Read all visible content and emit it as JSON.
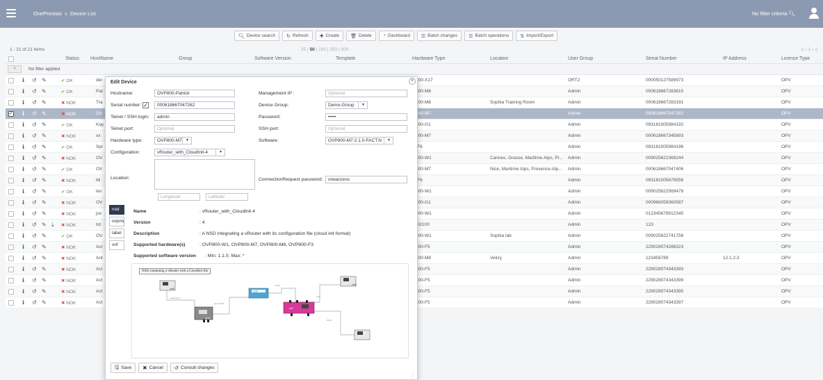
{
  "topbar": {
    "app": "OneProvisio",
    "separator": "»",
    "page": "Device List",
    "filter_criteria": "No filter criteria"
  },
  "toolbar": [
    {
      "label": "Device search",
      "icon": "search-icon"
    },
    {
      "label": "Refresh",
      "icon": "refresh-icon"
    },
    {
      "label": "Create",
      "icon": "plus-icon"
    },
    {
      "label": "Delete",
      "icon": "trash-icon"
    },
    {
      "label": "Dashboard",
      "icon": "dashboard-icon"
    },
    {
      "label": "Batch changes",
      "icon": "list-icon"
    },
    {
      "label": "Batch operations",
      "icon": "list-icon"
    },
    {
      "label": "Import/Export",
      "icon": "import-icon"
    }
  ],
  "list": {
    "count_text": "1 - 21 of 21 items",
    "pager": {
      "p25": "25",
      "p50": "50",
      "p100": "100",
      "p250": "250",
      "p500": "500",
      "sep": "|"
    },
    "pager_right": "|‹  ‹  1  ›  ›|",
    "filter_text": "No filter applied",
    "columns": {
      "status": "Status",
      "hostname": "HostName",
      "group": "Group",
      "software": "Software Version",
      "template": "Template",
      "hardware": "Hardware Type",
      "location": "Location",
      "user_group": "User Group",
      "serial": "Serial Number",
      "ip": "IP Address",
      "licence": "Licence Type"
    },
    "rows": [
      {
        "status": "OK",
        "host": "der",
        "hw": "800-X17",
        "loc": "",
        "ug": "ORT2",
        "sn": "000050127589973",
        "ip": "",
        "lic": "OPV"
      },
      {
        "status": "OK",
        "host": "Pat",
        "hw": "800-M8",
        "loc": "",
        "ug": "Admin",
        "sn": "000618667283815",
        "ip": "",
        "lic": "OPV"
      },
      {
        "status": "NOK",
        "host": "Tra",
        "hw": "800-M8",
        "loc": "Sophia Training Room",
        "ug": "Admin",
        "sn": "000618667283191",
        "ip": "",
        "lic": "OPV"
      },
      {
        "status": "NOK",
        "host": "OV",
        "hw": "800-M7",
        "loc": "",
        "ug": "Admin",
        "sn": "000618667047262",
        "ip": "",
        "lic": "OPV",
        "selected": true
      },
      {
        "status": "OK",
        "host": "Kay",
        "hw": "800-G1",
        "loc": "",
        "ug": "Admin",
        "sn": "093181005984192",
        "ip": "",
        "lic": "OPV"
      },
      {
        "status": "NOK",
        "host": "xx",
        "hw": "800-M7",
        "loc": "",
        "ug": "Admin",
        "sn": "000618667345893",
        "ip": "",
        "lic": "OPV"
      },
      {
        "status": "OK",
        "host": "Spr",
        "hw": "-F6",
        "loc": "",
        "ug": "Admin",
        "sn": "093181005984196",
        "ip": "",
        "lic": "OPV"
      },
      {
        "status": "NOK",
        "host": "OV",
        "hw": "800-W1",
        "loc": "Cannes, Grasse, Maritime Alps, Pr...",
        "ug": "Admin",
        "sn": "009025622369244",
        "ip": "",
        "lic": "OPV"
      },
      {
        "status": "OK",
        "host": "OV",
        "hw": "800-M7",
        "loc": "Nice, Maritime Alps, Provence-Alp...",
        "ug": "Admin",
        "sn": "000618667047406",
        "ip": "",
        "lic": "OPV"
      },
      {
        "status": "NOK",
        "host": "titi",
        "hw": "-F6",
        "loc": "",
        "ug": "Admin",
        "sn": "093181005679556",
        "ip": "",
        "lic": "OPV"
      },
      {
        "status": "OK",
        "host": "tes",
        "hw": "800-W1",
        "loc": "",
        "ug": "Admin",
        "sn": "009025622569478",
        "ip": "",
        "lic": "OPV"
      },
      {
        "status": "NOK",
        "host": "OV",
        "hw": "800-G1",
        "loc": "",
        "ug": "Admin",
        "sn": "000966059360587",
        "ip": "",
        "lic": "OPV"
      },
      {
        "status": "NOK",
        "host": "jos",
        "hw": "800-W1",
        "loc": "",
        "ug": "Admin",
        "sn": "012345678912345",
        "ip": "",
        "lic": "OPV"
      },
      {
        "status": "NOK",
        "host": "tot",
        "hw": "20/100",
        "loc": "",
        "ug": "Admin",
        "sn": "123",
        "ip": "",
        "lic": "OPV",
        "download": true
      },
      {
        "status": "OK",
        "host": "OV",
        "hw": "800-W1",
        "loc": "Sophia lab",
        "ug": "Admin",
        "sn": "009025622741756",
        "ip": "",
        "lic": "OPV"
      },
      {
        "status": "NOK",
        "host": "Act",
        "hw": "800-F5",
        "loc": "",
        "ug": "Admin",
        "sn": "229028074288323",
        "ip": "",
        "lic": "OPV"
      },
      {
        "status": "NOK",
        "host": "Ant",
        "hw": "800-M8",
        "loc": "Velizy",
        "ug": "Admin",
        "sn": "123456789",
        "ip": "12.1.2.3",
        "lic": "OPV"
      },
      {
        "status": "NOK",
        "host": "Act",
        "hw": "800-F5",
        "loc": "",
        "ug": "Admin",
        "sn": "229028074343393",
        "ip": "",
        "lic": "OPV"
      },
      {
        "status": "NOK",
        "host": "Act",
        "hw": "800-F5",
        "loc": "",
        "ug": "Admin",
        "sn": "229028074343399",
        "ip": "",
        "lic": "OPV"
      },
      {
        "status": "NOK",
        "host": "Act",
        "hw": "800-F5",
        "loc": "",
        "ug": "Admin",
        "sn": "229028074343395",
        "ip": "",
        "lic": "OPV"
      },
      {
        "status": "NOK",
        "host": "Act",
        "hw": "800-F5",
        "loc": "",
        "ug": "Admin",
        "sn": "229028074343397",
        "ip": "",
        "lic": "OPV"
      }
    ]
  },
  "modal": {
    "title": "Edit Device",
    "hostname_label": "Hostname:",
    "hostname_value": "OVP800-Patrick",
    "serial_label": "Serial number:",
    "serial_value": "000618667047262",
    "telnet_login_label": "Telnet / SSH login:",
    "telnet_login_value": "admin",
    "telnet_port_label": "Telnet port:",
    "telnet_port_placeholder": "Optional",
    "hwtype_label": "Hardware type:",
    "hwtype_value": "OVP800-M7",
    "config_label": "Configuration:",
    "config_value": "vRouter_with_CloudInit-4",
    "location_label": "Location:",
    "longitude_placeholder": "Longitude",
    "latitude_placeholder": "Latitude",
    "mgmt_ip_label": "Management IP :",
    "mgmt_ip_placeholder": "Optional",
    "device_group_label": "Device Group:",
    "device_group_value": "Demo-Group",
    "password_label": "Password:",
    "password_value": "•••••",
    "ssh_port_label": "SSH port:",
    "ssh_port_placeholder": "Optional",
    "software_label": "Software:",
    "software_value": "OVP800-M7-2.1.0-FACT.N",
    "conn_req_label": "ConnectionRequest password:",
    "conn_req_value": "oneaccess",
    "tabs": [
      "nsd",
      "ovpmgmt",
      "label",
      "vnf"
    ],
    "details": {
      "name_label": "Name",
      "name_value": ":  vRouter_with_CloudInit-4",
      "version_label": "Version",
      "version_value": ":  4",
      "description_label": "Description",
      "description_value": ":  A NSD integrating a vRouter with its configuration file (cloud init format)",
      "hw_label": "Supported hardware(s)",
      "hw_value": ":  OVP800-W1, OVP800-M7, OVP800-M8, OVP800-F3",
      "sw_label": "Supported software version",
      "sw_value": ":  Min: 1.1.0, Max: *"
    },
    "diagram": {
      "title": "NSD containing a vRouter with a CloudInit file",
      "nodes": {
        "ovp": "OVP",
        "vnf": "vnf",
        "vnf2": "vnf2",
        "vnf3": "vnf3",
        "ovp1": "ovp1"
      },
      "links": {
        "l1": "adminSvcs",
        "l2": "adminSVR",
        "l3": "LAN0",
        "l4": "LAN",
        "l5": "WAN"
      }
    },
    "save_label": "Save",
    "cancel_label": "Cancel",
    "consult_label": "Consult changes"
  }
}
